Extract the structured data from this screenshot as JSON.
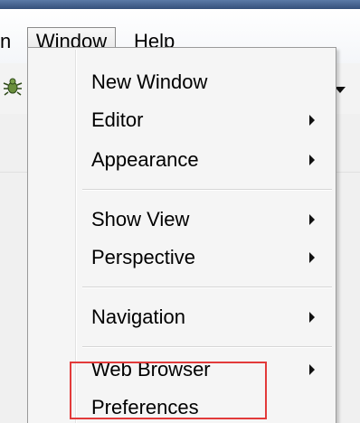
{
  "menubar": {
    "partial_left": "n",
    "window_label": "Window",
    "help_label": "Help"
  },
  "window_menu": {
    "items": [
      {
        "label": "New Window",
        "has_submenu": false
      },
      {
        "label": "Editor",
        "has_submenu": true
      },
      {
        "label": "Appearance",
        "has_submenu": true
      },
      {
        "label": "Show View",
        "has_submenu": true
      },
      {
        "label": "Perspective",
        "has_submenu": true
      },
      {
        "label": "Navigation",
        "has_submenu": true
      },
      {
        "label": "Web Browser",
        "has_submenu": true
      },
      {
        "label": "Preferences",
        "has_submenu": false
      }
    ]
  },
  "colors": {
    "highlight_box": "#e23a3a",
    "menu_bg": "#f5f5f5"
  },
  "icons": {
    "toolbar_left": "debug-bug-icon",
    "toolbar_right": "dropdown-arrow-icon",
    "submenu": "submenu-arrow-icon"
  }
}
